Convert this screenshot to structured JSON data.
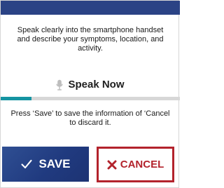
{
  "screen": {
    "instructions": "Speak clearly into the smartphone handset and describe your symptoms, location, and activity.",
    "status_label": "Speak Now",
    "progress": 0.17,
    "save_instructions": "Press ‘Save’ to save the information of ‘Cancel to discard it.",
    "actions": {
      "save_label": "SAVE",
      "cancel_label": "CANCEL"
    }
  },
  "icons": {
    "status": "microphone-icon",
    "save": "checkmark-icon",
    "cancel": "x-icon"
  },
  "colors": {
    "top_bar": "#2b4385",
    "progress_track": "#d7d7d7",
    "progress_fill": "#1594a2",
    "save_button": "#203a7f",
    "cancel_accent": "#b3232c"
  }
}
